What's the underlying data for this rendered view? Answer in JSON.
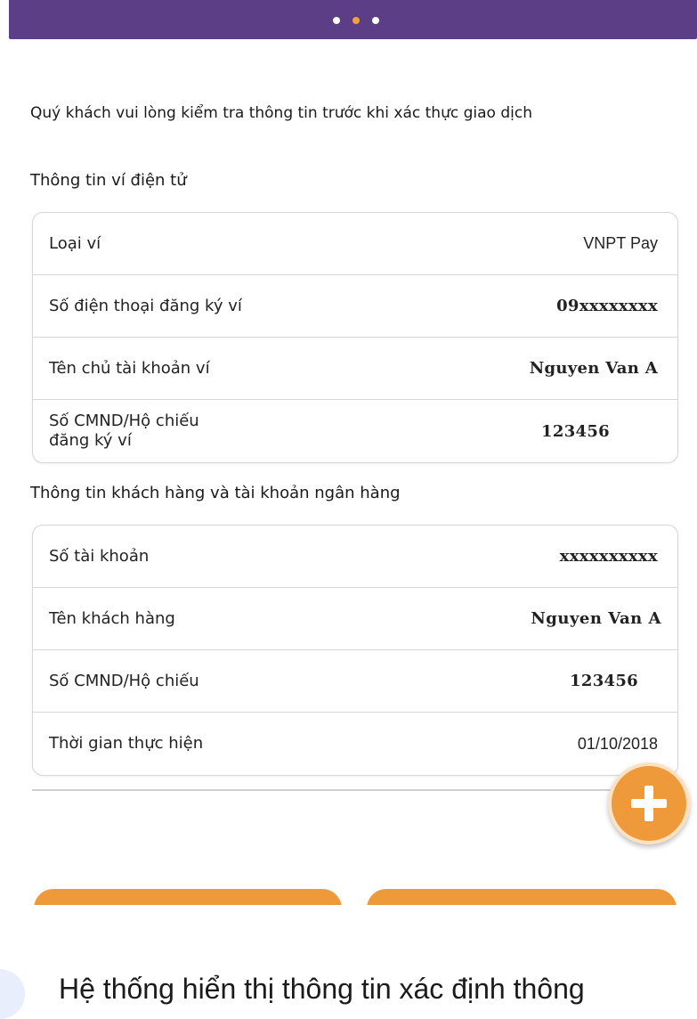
{
  "header": {
    "dots": 3,
    "active_dot": 1
  },
  "intro_text": "Quý khách vui lòng kiểm tra thông tin trước khi xác thực giao dịch",
  "wallet_section": {
    "title": "Thông tin ví điện tử",
    "rows": [
      {
        "label": "Loại ví",
        "value": "VNPT Pay"
      },
      {
        "label": "Số điện thoại đăng ký ví",
        "value": "09xxxxxxxx"
      },
      {
        "label": "Tên chủ tài khoản ví",
        "value": "Nguyen Van A"
      },
      {
        "label": "Số CMND/Hộ chiếu\nđăng ký ví",
        "value": "123456"
      }
    ]
  },
  "bank_section": {
    "title": "Thông tin khách hàng và tài khoản ngân hàng",
    "rows": [
      {
        "label": "Số tài khoản",
        "value": "xxxxxxxxxx"
      },
      {
        "label": "Tên khách hàng",
        "value": "Nguyen Van A"
      },
      {
        "label": "Số CMND/Hộ chiếu",
        "value": "123456"
      },
      {
        "label": "Thời gian thực hiện",
        "value": "01/10/2018"
      }
    ]
  },
  "caption": "Hệ thống hiển thị thông tin xác định thông",
  "colors": {
    "header": "#5b3e86",
    "accent": "#ee9a3a"
  }
}
